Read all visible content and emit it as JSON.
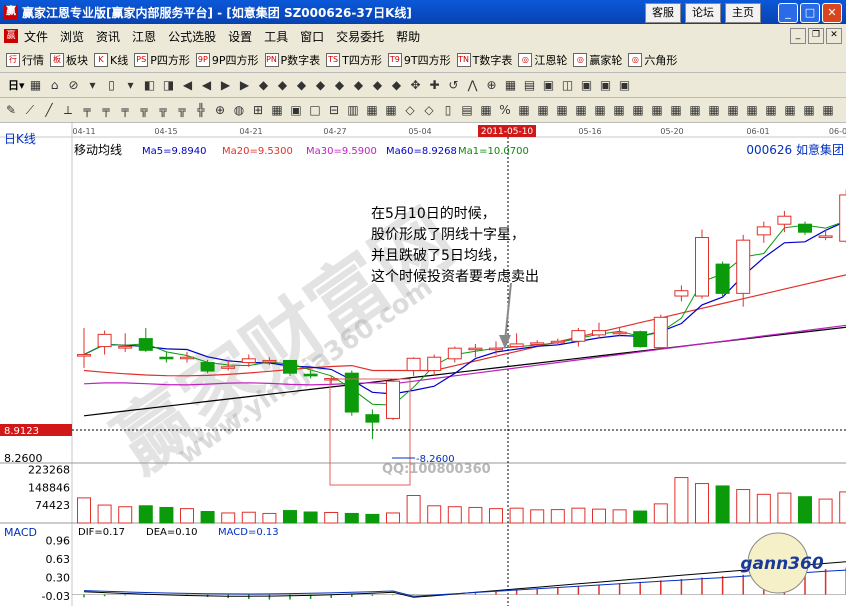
{
  "window": {
    "icon_text": "赢",
    "title": "赢家江恩专业版[赢家内部服务平台] - [如意集团   SZ000626-37日K线]",
    "btn_service": "客服",
    "btn_forum": "论坛",
    "btn_home": "主页"
  },
  "menu": {
    "icon_text": "赢",
    "items": [
      "文件",
      "浏览",
      "资讯",
      "江恩",
      "公式选股",
      "设置",
      "工具",
      "窗口",
      "交易委托",
      "帮助"
    ]
  },
  "toolbar1": {
    "items": [
      {
        "icon": "行",
        "label": "行情"
      },
      {
        "icon": "板",
        "label": "板块"
      },
      {
        "icon": "K",
        "label": "K线"
      },
      {
        "icon": "PS",
        "label": "P四方形"
      },
      {
        "icon": "9P",
        "label": "9P四方形"
      },
      {
        "icon": "PN",
        "label": "P数字表"
      },
      {
        "icon": "TS",
        "label": "T四方形"
      },
      {
        "icon": "T9",
        "label": "9T四方形"
      },
      {
        "icon": "TN",
        "label": "T数字表"
      },
      {
        "icon": "◎",
        "label": "江恩轮"
      },
      {
        "icon": "◎",
        "label": "赢家轮"
      },
      {
        "icon": "◎",
        "label": "六角形"
      }
    ]
  },
  "toolbar2": {
    "lead": "日▾",
    "glyphs": [
      "▦",
      "⌂",
      "⊘",
      "▾",
      "▯",
      "▾",
      "◧",
      "◨",
      "◀",
      "◀",
      "▶",
      "▶",
      "◆",
      "◆",
      "◆",
      "◆",
      "◆",
      "◆",
      "◆",
      "◆",
      "✥",
      "✚",
      "↺",
      "⋀",
      "⊕",
      "▦",
      "▤",
      "▣",
      "◫",
      "▣",
      "▣",
      "▣"
    ]
  },
  "toolbar3": {
    "glyphs": [
      "✎",
      "⟋",
      "╱",
      "⟂",
      "╤",
      "╤",
      "╤",
      "╦",
      "╦",
      "╦",
      "╬",
      "⊕",
      "◍",
      "⊞",
      "▦",
      "▣",
      "□",
      "⊟",
      "▥",
      "▦",
      "▦",
      "◇",
      "◇",
      "▯",
      "▤",
      "▦",
      "%",
      "▦",
      "▦",
      "▦",
      "▦",
      "▦",
      "▦",
      "▦",
      "▦",
      "▦",
      "▦",
      "▦",
      "▦",
      "▦",
      "▦",
      "▦",
      "▦",
      "▦"
    ]
  },
  "chart": {
    "period_label": "日K线",
    "ma_title": "移动均线",
    "ma5": "Ma5=9.8940",
    "ma20": "Ma20=9.5300",
    "ma30": "Ma30=9.5900",
    "ma60": "Ma60=8.9268",
    "ma1": "Ma1=10.0700",
    "stock": "000626 如意集团",
    "date_ticks": [
      "04-11",
      "04-15",
      "04-21",
      "04-27",
      "05-04",
      "05-16",
      "05-20",
      "06-01",
      "06-0"
    ],
    "cursor_date": "2011-05-10",
    "price_cursor": "8.9123",
    "price_low": "8.2600",
    "low_marker": "8.2600",
    "qq": "QQ:100800360",
    "annotation": [
      "在5月10日的时候，",
      "股价形成了阴线十字星，",
      "并且跌破了5日均线，",
      "这个时候投资者要考虑卖出"
    ],
    "watermark": "赢家财富网",
    "watermark_url": "www.yingjia360.com",
    "vol_ticks": [
      "223268",
      "148846",
      "74423"
    ],
    "macd_title": "MACD",
    "dif": "DIF=0.17",
    "dea": "DEA=0.10",
    "macd": "MACD=0.13",
    "macd_ticks": [
      "0.96",
      "0.63",
      "0.30",
      "-0.03"
    ],
    "logo": "gann360",
    "colors": {
      "up": "#e0302a",
      "down": "#0a9a0a",
      "ma5": "#0000cc",
      "ma20": "#e0302a",
      "ma30": "#c020c0",
      "ma60": "#000000"
    }
  },
  "chart_data": {
    "type": "candlestick",
    "candles": [
      {
        "o": 9.85,
        "c": 9.85,
        "h": 10.35,
        "l": 9.6,
        "v": 105000
      },
      {
        "o": 10.0,
        "c": 10.23,
        "h": 10.3,
        "l": 9.85,
        "v": 75000
      },
      {
        "o": 9.98,
        "c": 10.0,
        "h": 10.25,
        "l": 9.9,
        "v": 68000
      },
      {
        "o": 10.15,
        "c": 9.93,
        "h": 10.35,
        "l": 9.9,
        "v": 72000
      },
      {
        "o": 9.8,
        "c": 9.77,
        "h": 9.9,
        "l": 9.7,
        "v": 65000
      },
      {
        "o": 9.8,
        "c": 9.8,
        "h": 9.9,
        "l": 9.7,
        "v": 60000
      },
      {
        "o": 9.7,
        "c": 9.54,
        "h": 9.75,
        "l": 9.5,
        "v": 48000
      },
      {
        "o": 9.62,
        "c": 9.62,
        "h": 9.75,
        "l": 9.55,
        "v": 42000
      },
      {
        "o": 9.7,
        "c": 9.77,
        "h": 9.85,
        "l": 9.62,
        "v": 45000
      },
      {
        "o": 9.73,
        "c": 9.74,
        "h": 9.8,
        "l": 9.65,
        "v": 40000
      },
      {
        "o": 9.74,
        "c": 9.5,
        "h": 9.75,
        "l": 9.45,
        "v": 52000
      },
      {
        "o": 9.48,
        "c": 9.45,
        "h": 9.55,
        "l": 9.4,
        "v": 46000
      },
      {
        "o": 9.4,
        "c": 9.4,
        "h": 9.45,
        "l": 9.3,
        "v": 44000
      },
      {
        "o": 9.5,
        "c": 8.77,
        "h": 9.55,
        "l": 8.7,
        "v": 40000
      },
      {
        "o": 8.72,
        "c": 8.58,
        "h": 8.82,
        "l": 8.26,
        "v": 36000
      },
      {
        "o": 8.65,
        "c": 9.35,
        "h": 9.4,
        "l": 8.62,
        "v": 42000
      },
      {
        "o": 9.55,
        "c": 9.78,
        "h": 9.8,
        "l": 9.45,
        "v": 115000
      },
      {
        "o": 9.55,
        "c": 9.8,
        "h": 9.85,
        "l": 9.45,
        "v": 72000
      },
      {
        "o": 9.77,
        "c": 9.97,
        "h": 10.0,
        "l": 9.7,
        "v": 68000
      },
      {
        "o": 9.97,
        "c": 9.97,
        "h": 10.05,
        "l": 9.8,
        "v": 65000
      },
      {
        "o": 9.97,
        "c": 9.97,
        "h": 10.1,
        "l": 9.85,
        "v": 60000
      },
      {
        "o": 10.0,
        "c": 10.05,
        "h": 10.25,
        "l": 9.98,
        "v": 62000
      },
      {
        "o": 10.05,
        "c": 10.07,
        "h": 10.12,
        "l": 10.0,
        "v": 55000
      },
      {
        "o": 10.08,
        "c": 10.1,
        "h": 10.15,
        "l": 10.02,
        "v": 56000
      },
      {
        "o": 10.1,
        "c": 10.3,
        "h": 10.35,
        "l": 10.0,
        "v": 62000
      },
      {
        "o": 10.22,
        "c": 10.3,
        "h": 10.45,
        "l": 10.15,
        "v": 58000
      },
      {
        "o": 10.25,
        "c": 10.27,
        "h": 10.35,
        "l": 10.2,
        "v": 55000
      },
      {
        "o": 10.28,
        "c": 10.0,
        "h": 10.3,
        "l": 9.98,
        "v": 50000
      },
      {
        "o": 9.98,
        "c": 10.55,
        "h": 10.6,
        "l": 9.95,
        "v": 80000
      },
      {
        "o": 10.95,
        "c": 11.05,
        "h": 11.15,
        "l": 10.85,
        "v": 190000
      },
      {
        "o": 10.95,
        "c": 12.05,
        "h": 12.2,
        "l": 10.9,
        "v": 165000
      },
      {
        "o": 11.55,
        "c": 11.0,
        "h": 11.6,
        "l": 10.95,
        "v": 155000
      },
      {
        "o": 11.0,
        "c": 12.0,
        "h": 12.1,
        "l": 10.75,
        "v": 140000
      },
      {
        "o": 12.1,
        "c": 12.25,
        "h": 12.35,
        "l": 11.95,
        "v": 120000
      },
      {
        "o": 12.3,
        "c": 12.45,
        "h": 12.55,
        "l": 12.15,
        "v": 125000
      },
      {
        "o": 12.3,
        "c": 12.15,
        "h": 12.35,
        "l": 12.1,
        "v": 110000
      },
      {
        "o": 12.08,
        "c": 12.08,
        "h": 12.2,
        "l": 12.0,
        "v": 100000
      },
      {
        "o": 11.98,
        "c": 12.85,
        "h": 12.95,
        "l": 11.95,
        "v": 130000
      },
      {
        "o": 12.75,
        "c": 12.95,
        "h": 13.05,
        "l": 12.7,
        "v": 140000
      }
    ],
    "ma5_note": "computed"
  }
}
